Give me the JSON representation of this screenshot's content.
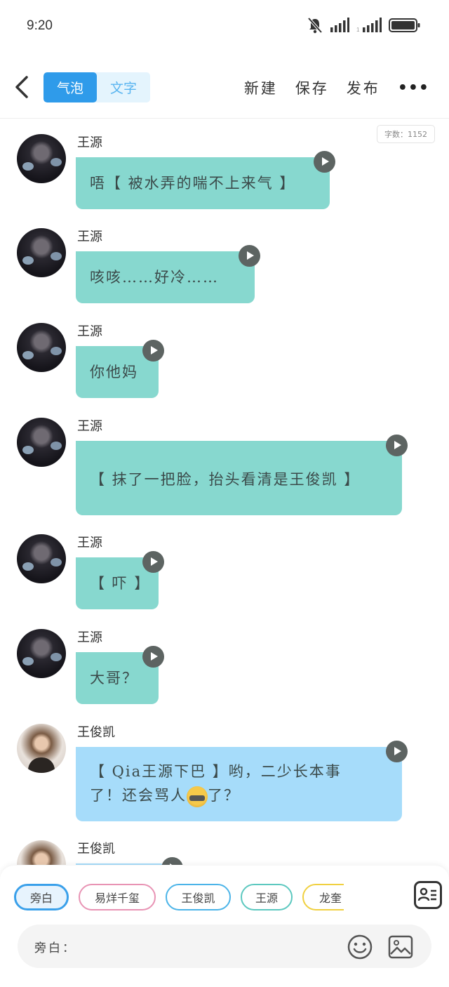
{
  "status_bar": {
    "time": "9:20"
  },
  "header": {
    "tabs": [
      {
        "label": "气泡",
        "active": true
      },
      {
        "label": "文字",
        "active": false
      }
    ],
    "actions": {
      "new": "新建",
      "save": "保存",
      "publish": "发布",
      "more": "•••"
    }
  },
  "chat": {
    "word_count": "字数：1152",
    "messages": [
      {
        "sender": "王源",
        "text": "唔【 被水弄的喘不上来气 】",
        "avatar": "wang-yuan"
      },
      {
        "sender": "王源",
        "text": "咳咳……好冷……",
        "avatar": "wang-yuan"
      },
      {
        "sender": "王源",
        "text": "你他妈",
        "avatar": "wang-yuan"
      },
      {
        "sender": "王源",
        "text": "【 抹了一把脸，抬头看清是王俊凯 】",
        "avatar": "wang-yuan"
      },
      {
        "sender": "王源",
        "text": "【 吓 】",
        "avatar": "wang-yuan"
      },
      {
        "sender": "王源",
        "text": "大哥？",
        "avatar": "wang-yuan"
      },
      {
        "sender": "王俊凯",
        "text_line1": "【 Qia王源下巴 】哟，二少长本事",
        "text_line2a": "了！还会骂人",
        "text_line2b": "了？",
        "avatar": "wang-junkai"
      },
      {
        "sender": "王俊凯",
        "text": "",
        "avatar": "wang-junkai"
      }
    ]
  },
  "bottom": {
    "chips": [
      "旁白",
      "易烊千玺",
      "王俊凯",
      "王源",
      "龙奎"
    ],
    "input_prefix": "旁白：",
    "input_value": "",
    "colors": {
      "narration": "#3aa0ea",
      "yyqx": "#e893b4",
      "wjk": "#4bb4e8",
      "wy": "#5cc8bf",
      "lk": "#f0d040"
    }
  },
  "colors": {
    "bubble_green": "#87d8cf",
    "bubble_blue": "#a6dcfa",
    "accent": "#2f9bea"
  },
  "icons": [
    "back-icon",
    "bell-off-icon",
    "signal-icon",
    "battery-icon",
    "play-icon",
    "role-card-icon",
    "smile-icon",
    "image-icon"
  ]
}
